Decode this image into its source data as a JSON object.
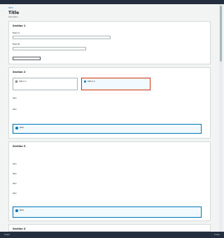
{
  "breadcrumb": "Path",
  "title": "Title",
  "description": "Description",
  "general": {
    "heading": "Section 1",
    "fields": [
      {
        "label": "Field A",
        "value": "Value"
      },
      {
        "label": "Field B",
        "value": "Value"
      }
    ],
    "button": "Button"
  },
  "ownership": {
    "heading": "Section 2",
    "options": [
      {
        "label": "Option 1"
      },
      {
        "label": "Option 2"
      }
    ],
    "rows": [
      "Item",
      "Item"
    ],
    "callout": "Note"
  },
  "public_access": {
    "heading": "Section 3",
    "options": [
      "Item",
      "Item",
      "Item",
      "Item"
    ],
    "callout": "Note"
  },
  "versioning": {
    "heading": "Section 4"
  },
  "footer": {
    "left": "Footer",
    "right": "Footer"
  }
}
